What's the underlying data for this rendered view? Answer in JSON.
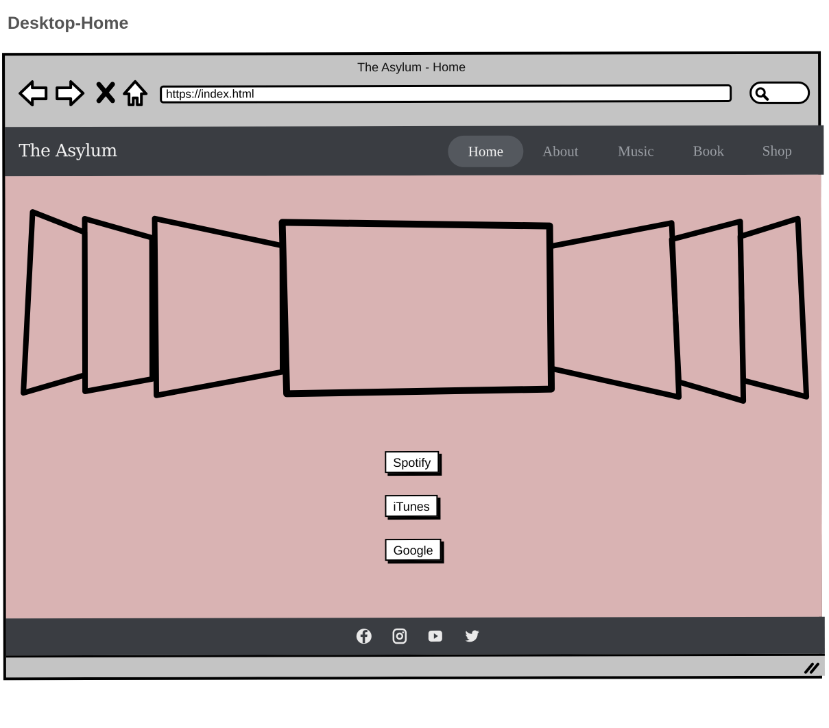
{
  "frame": {
    "label": "Desktop-Home"
  },
  "browser": {
    "title": "The Asylum - Home",
    "url": "https://index.html",
    "icons": [
      "back-arrow-icon",
      "forward-arrow-icon",
      "close-icon",
      "home-icon",
      "search-icon"
    ]
  },
  "site": {
    "brand": "The Asylum",
    "nav": [
      {
        "label": "Home",
        "active": true
      },
      {
        "label": "About",
        "active": false
      },
      {
        "label": "Music",
        "active": false
      },
      {
        "label": "Book",
        "active": false
      },
      {
        "label": "Shop",
        "active": false
      }
    ]
  },
  "carousel": {
    "image_count": 7
  },
  "streaming": {
    "buttons": [
      "Spotify",
      "iTunes",
      "Google"
    ]
  },
  "footer": {
    "icons": [
      "facebook-icon",
      "instagram-icon",
      "youtube-icon",
      "twitter-icon"
    ]
  },
  "colors": {
    "chrome": "#c4c4c4",
    "header": "#3a3d42",
    "body": "#d9b3b3",
    "nav_active": "#54585e",
    "nav_text": "#9a9ea4"
  }
}
